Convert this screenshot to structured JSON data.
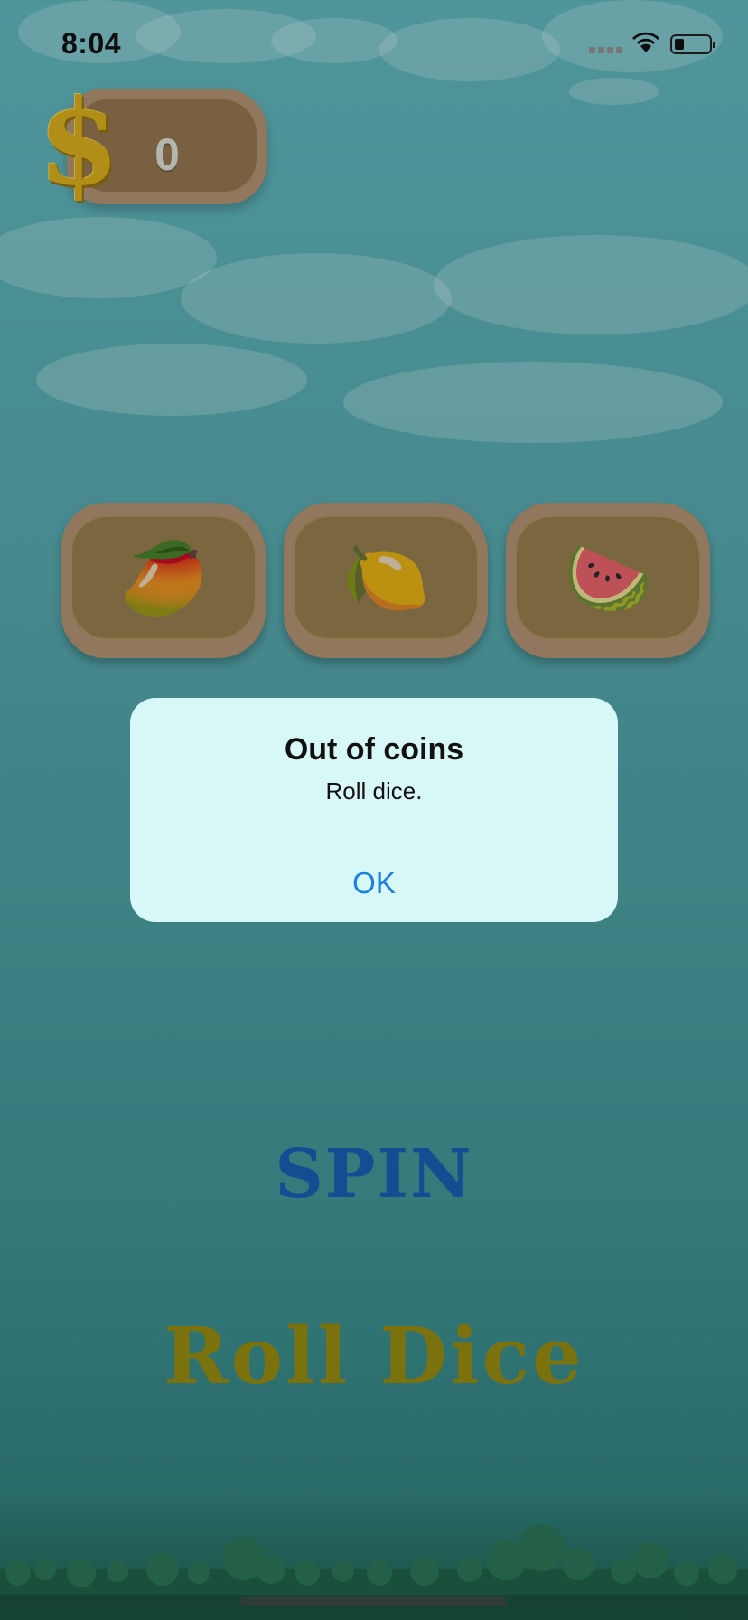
{
  "status_bar": {
    "time": "8:04"
  },
  "coins": {
    "value": "0",
    "currency_symbol": "$"
  },
  "slots": [
    {
      "fruit": "🥭",
      "icon": "mango-icon"
    },
    {
      "fruit": "🍋",
      "icon": "lemon-icon"
    },
    {
      "fruit": "🍉",
      "icon": "watermelon-icon"
    }
  ],
  "alert": {
    "title": "Out of coins",
    "message": "Roll dice.",
    "ok_label": "OK"
  },
  "buttons": {
    "spin_label": "SPIN",
    "roll_dice_label": "Roll Dice"
  },
  "colors": {
    "background": "#4f9ba0",
    "alert_bg": "#d8f7f7",
    "alert_button": "#1a7fe0",
    "spin": "#1858a8",
    "roll": "#8c8210"
  }
}
